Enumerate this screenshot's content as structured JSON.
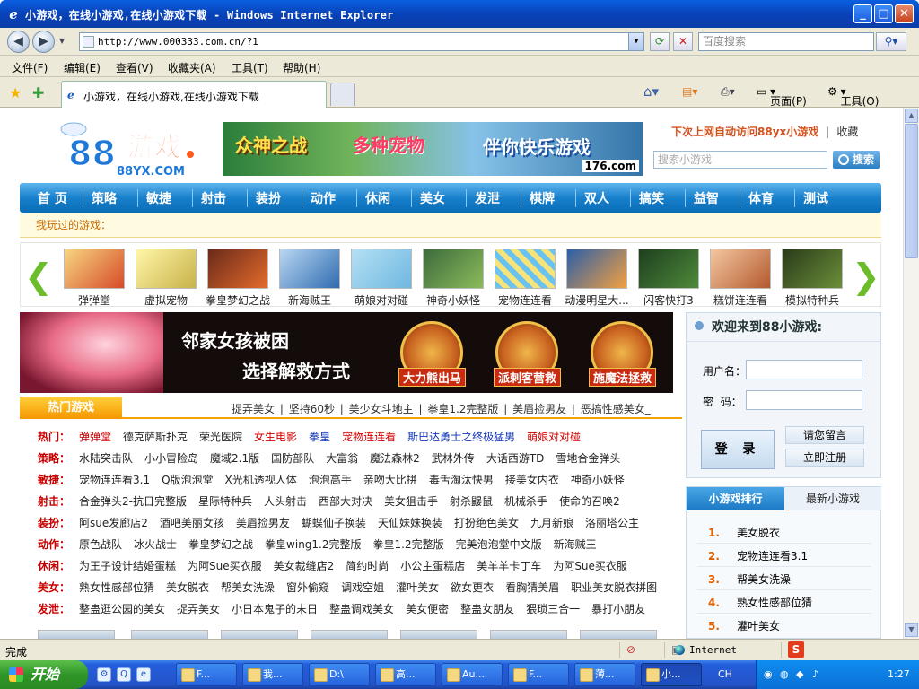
{
  "window": {
    "title": "小游戏，在线小游戏,在线小游戏下载 - Windows Internet Explorer",
    "minimize": "_",
    "maximize": "□",
    "close": "✕"
  },
  "addressbar": {
    "url": "http://www.000333.com.cn/?1",
    "search_placeholder": "百度搜索"
  },
  "menu": [
    "文件(F)",
    "编辑(E)",
    "查看(V)",
    "收藏夹(A)",
    "工具(T)",
    "帮助(H)"
  ],
  "tab": {
    "title": "小游戏，在线小游戏,在线小游戏下载"
  },
  "toolbar": {
    "page": "页面(P)",
    "tools": "工具(O)"
  },
  "site": {
    "logo_text": "88游戏",
    "logo_domain": "88YX.COM",
    "banner": {
      "left": "众神之战",
      "middle": "多种宠物",
      "right": "伴你快乐游戏",
      "domain": "176.com"
    },
    "auto_visit": "下次上网自动访问88yx小游戏",
    "favorite": "收藏",
    "search_placeholder": "搜索小游戏",
    "search_button": "搜索",
    "nav": [
      "首 页",
      "策略",
      "敏捷",
      "射击",
      "装扮",
      "动作",
      "休闲",
      "美女",
      "发泄",
      "棋牌",
      "双人",
      "搞笑",
      "益智",
      "体育",
      "测试"
    ],
    "played_label": "我玩过的游戏：",
    "carousel": [
      "弹弹堂",
      "虚拟宠物",
      "拳皇梦幻之战",
      "新海贼王",
      "萌娘对对碰",
      "神奇小妖怪",
      "宠物连连看",
      "动漫明星大...",
      "闪客快打3",
      "糕饼连连看",
      "模拟特种兵"
    ],
    "big_banner": {
      "line1": "邻家女孩被困",
      "line2": "选择解救方式",
      "opt1": "大力熊出马",
      "opt2": "派刺客营救",
      "opt3": "施魔法拯救"
    },
    "hot_tab": "热门游戏",
    "hot_links": [
      "捉弄美女",
      "坚持60秒",
      "美少女斗地主",
      "拳皇1.2完整版",
      "美眉捡男友",
      "恶搞性感美女_"
    ],
    "categories": [
      {
        "name": "热门：",
        "items": [
          {
            "t": "弹弹堂",
            "c": "red"
          },
          {
            "t": "德克萨斯扑克",
            "c": ""
          },
          {
            "t": "荣光医院",
            "c": ""
          },
          {
            "t": "女生电影",
            "c": "red"
          },
          {
            "t": "拳皇",
            "c": "blue"
          },
          {
            "t": "宠物连连看",
            "c": "red"
          },
          {
            "t": "斯巴达勇士之终极猛男",
            "c": "blue"
          },
          {
            "t": "萌娘对对碰",
            "c": "red"
          }
        ]
      },
      {
        "name": "策略：",
        "items": [
          {
            "t": "水陆突击队",
            "c": ""
          },
          {
            "t": "小小冒险岛",
            "c": ""
          },
          {
            "t": "魔域2.1版",
            "c": ""
          },
          {
            "t": "国防部队",
            "c": ""
          },
          {
            "t": "大富翁",
            "c": ""
          },
          {
            "t": "魔法森林2",
            "c": ""
          },
          {
            "t": "武林外传",
            "c": ""
          },
          {
            "t": "大话西游TD",
            "c": ""
          },
          {
            "t": "雪地合金弹头",
            "c": ""
          }
        ]
      },
      {
        "name": "敏捷：",
        "items": [
          {
            "t": "宠物连连看3.1",
            "c": ""
          },
          {
            "t": "Q版泡泡堂",
            "c": ""
          },
          {
            "t": "X光机透视人体",
            "c": ""
          },
          {
            "t": "泡泡高手",
            "c": ""
          },
          {
            "t": "亲吻大比拼",
            "c": ""
          },
          {
            "t": "毒舌淘汰快男",
            "c": ""
          },
          {
            "t": "接美女内衣",
            "c": ""
          },
          {
            "t": "神奇小妖怪",
            "c": ""
          }
        ]
      },
      {
        "name": "射击：",
        "items": [
          {
            "t": "合金弹头2-抗日完整版",
            "c": ""
          },
          {
            "t": "星际特种兵",
            "c": ""
          },
          {
            "t": "人头射击",
            "c": ""
          },
          {
            "t": "西部大对决",
            "c": ""
          },
          {
            "t": "美女狙击手",
            "c": ""
          },
          {
            "t": "射杀鼹鼠",
            "c": ""
          },
          {
            "t": "机械杀手",
            "c": ""
          },
          {
            "t": "使命的召唤2",
            "c": ""
          }
        ]
      },
      {
        "name": "装扮：",
        "items": [
          {
            "t": "阿sue发廊店2",
            "c": ""
          },
          {
            "t": "酒吧美丽女孩",
            "c": ""
          },
          {
            "t": "美眉捡男友",
            "c": ""
          },
          {
            "t": "蝴蝶仙子换装",
            "c": ""
          },
          {
            "t": "天仙妹妹换装",
            "c": ""
          },
          {
            "t": "打扮绝色美女",
            "c": ""
          },
          {
            "t": "九月新娘",
            "c": ""
          },
          {
            "t": "洛丽塔公主",
            "c": ""
          }
        ]
      },
      {
        "name": "动作：",
        "items": [
          {
            "t": "原色战队",
            "c": ""
          },
          {
            "t": "冰火战士",
            "c": ""
          },
          {
            "t": "拳皇梦幻之战",
            "c": ""
          },
          {
            "t": "拳皇wing1.2完整版",
            "c": ""
          },
          {
            "t": "拳皇1.2完整版",
            "c": ""
          },
          {
            "t": "完美泡泡堂中文版",
            "c": ""
          },
          {
            "t": "新海贼王",
            "c": ""
          }
        ]
      },
      {
        "name": "休闲：",
        "items": [
          {
            "t": "为王子设计结婚蛋糕",
            "c": ""
          },
          {
            "t": "为阿Sue买衣服",
            "c": ""
          },
          {
            "t": "美女裁缝店2",
            "c": ""
          },
          {
            "t": "简约时尚",
            "c": ""
          },
          {
            "t": "小公主蛋糕店",
            "c": ""
          },
          {
            "t": "美羊羊卡丁车",
            "c": ""
          },
          {
            "t": "为阿Sue买衣服",
            "c": ""
          }
        ]
      },
      {
        "name": "美女：",
        "items": [
          {
            "t": "熟女性感部位猜",
            "c": ""
          },
          {
            "t": "美女脱衣",
            "c": ""
          },
          {
            "t": "帮美女洗澡",
            "c": ""
          },
          {
            "t": "窗外偷窥",
            "c": ""
          },
          {
            "t": "调戏空姐",
            "c": ""
          },
          {
            "t": "灌叶美女",
            "c": ""
          },
          {
            "t": "欲女更衣",
            "c": ""
          },
          {
            "t": "看胸猜美眉",
            "c": ""
          },
          {
            "t": "职业美女脱衣拼图",
            "c": ""
          }
        ]
      },
      {
        "name": "发泄：",
        "items": [
          {
            "t": "整蛊逛公园的美女",
            "c": ""
          },
          {
            "t": "捉弄美女",
            "c": ""
          },
          {
            "t": "小日本鬼子的末日",
            "c": ""
          },
          {
            "t": "整蛊调戏美女",
            "c": ""
          },
          {
            "t": "美女便密",
            "c": ""
          },
          {
            "t": "整蛊女朋友",
            "c": ""
          },
          {
            "t": "猥琐三合一",
            "c": ""
          },
          {
            "t": "暴打小朋友",
            "c": ""
          }
        ]
      }
    ],
    "login": {
      "welcome": "欢迎来到88小游戏:",
      "user_label": "用户名：",
      "pass_label": "密  码：",
      "login_button": "登 录",
      "leave_msg": "请您留言",
      "register": "立即注册"
    },
    "rank": {
      "tab_active": "小游戏排行",
      "tab_other": "最新小游戏",
      "items": [
        {
          "n": "1.",
          "t": "美女脱衣"
        },
        {
          "n": "2.",
          "t": "宠物连连看3.1"
        },
        {
          "n": "3.",
          "t": "帮美女洗澡"
        },
        {
          "n": "4.",
          "t": "熟女性感部位猜"
        },
        {
          "n": "5.",
          "t": "灌叶美女"
        }
      ]
    }
  },
  "status": {
    "text": "完成",
    "zone": "Internet"
  },
  "taskbar": {
    "start": "开始",
    "tasks": [
      "F...",
      "我...",
      "D:\\",
      "高...",
      "Au...",
      "F...",
      "薄...",
      "小..."
    ],
    "tray_lang": "CH",
    "clock": "1:27"
  }
}
